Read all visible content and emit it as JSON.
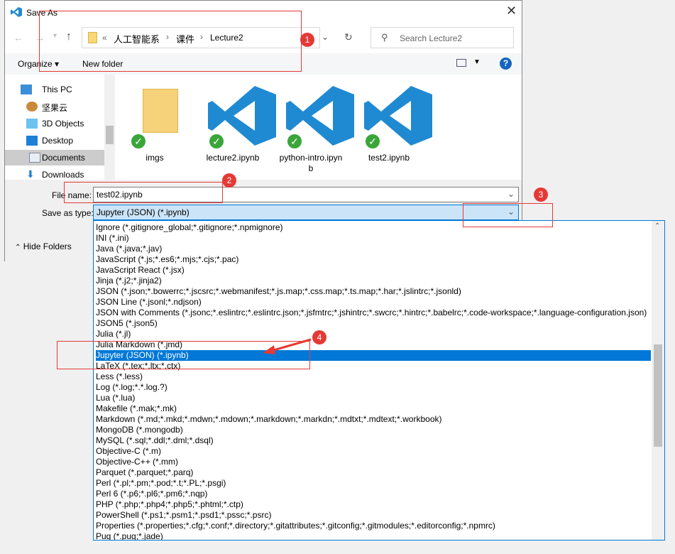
{
  "window": {
    "title": "Save As",
    "close": "✕"
  },
  "address": {
    "prefix": "«",
    "crumbs": [
      "人工智能系",
      "课件",
      "Lecture2"
    ],
    "sep": "›"
  },
  "search": {
    "placeholder": "Search Lecture2"
  },
  "toolbar": {
    "organize": "Organize ▾",
    "new_folder": "New folder",
    "help": "?"
  },
  "sidebar": {
    "items": [
      {
        "label": "This PC",
        "icon": "pc-icon"
      },
      {
        "label": "坚果云",
        "icon": "nut-icon"
      },
      {
        "label": "3D Objects",
        "icon": "cube-icon"
      },
      {
        "label": "Desktop",
        "icon": "desktop-icon"
      },
      {
        "label": "Documents",
        "icon": "document-icon",
        "selected": true
      },
      {
        "label": "Downloads",
        "icon": "download-icon"
      }
    ]
  },
  "files": [
    {
      "name": "imgs",
      "type": "folder"
    },
    {
      "name": "lecture2.ipynb",
      "type": "vscode"
    },
    {
      "name": "python-intro.ipynb",
      "type": "vscode"
    },
    {
      "name": "test2.ipynb",
      "type": "vscode"
    }
  ],
  "form": {
    "file_name_label": "File name:",
    "file_name_value": "test02.ipynb",
    "type_label": "Save as type:",
    "type_value": "Jupyter (JSON) (*.ipynb)",
    "hide_folders": "Hide Folders"
  },
  "type_options": [
    "Ignore (*.gitignore_global;*.gitignore;*.npmignore)",
    "INI (*.ini)",
    "Java (*.java;*.jav)",
    "JavaScript (*.js;*.es6;*.mjs;*.cjs;*.pac)",
    "JavaScript React (*.jsx)",
    "Jinja (*.j2;*.jinja2)",
    "JSON (*.json;*.bowerrc;*.jscsrc;*.webmanifest;*.js.map;*.css.map;*.ts.map;*.har;*.jslintrc;*.jsonld)",
    "JSON Line (*.jsonl;*.ndjson)",
    "JSON with Comments (*.jsonc;*.eslintrc;*.eslintrc.json;*.jsfmtrc;*.jshintrc;*.swcrc;*.hintrc;*.babelrc;*.code-workspace;*.language-configuration.json)",
    "JSON5 (*.json5)",
    "Julia (*.jl)",
    "Julia Markdown (*.jmd)",
    "Jupyter (JSON) (*.ipynb)",
    "LaTeX (*.tex;*.ltx;*.ctx)",
    "Less (*.less)",
    "Log (*.log;*.*.log.?)",
    "Lua (*.lua)",
    "Makefile (*.mak;*.mk)",
    "Markdown (*.md;*.mkd;*.mdwn;*.mdown;*.markdown;*.markdn;*.mdtxt;*.mdtext;*.workbook)",
    "MongoDB (*.mongodb)",
    "MySQL (*.sql;*.ddl;*.dml;*.dsql)",
    "Objective-C (*.m)",
    "Objective-C++ (*.mm)",
    "Parquet (*.parquet;*.parq)",
    "Perl (*.pl;*.pm;*.pod;*.t;*.PL;*.psgi)",
    "Perl 6 (*.p6;*.pl6;*.pm6;*.nqp)",
    "PHP (*.php;*.php4;*.php5;*.phtml;*.ctp)",
    "PowerShell (*.ps1;*.psm1;*.psd1;*.pssc;*.psrc)",
    "Properties (*.properties;*.cfg;*.conf;*.directory;*.gitattributes;*.gitconfig;*.gitmodules;*.editorconfig;*.npmrc)",
    "Pug (*.pug;*.jade)"
  ],
  "selected_option": "Jupyter (JSON) (*.ipynb)",
  "annotations": [
    "1",
    "2",
    "3",
    "4"
  ],
  "colors": {
    "accent": "#0078d7",
    "annotation": "#e53935"
  }
}
